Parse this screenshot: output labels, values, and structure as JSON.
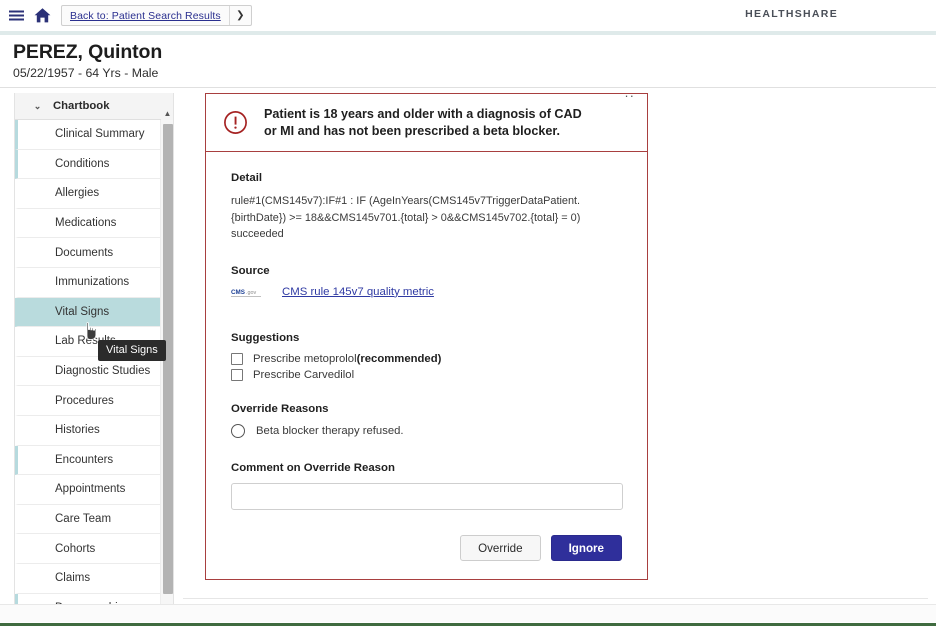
{
  "header": {
    "menu_icon": "hamburger-menu-icon",
    "home_icon": "home-icon",
    "back_crumb_label": "Back to: Patient Search Results",
    "back_crumb_arrow": "❯",
    "brand": "HEALTHSHARE"
  },
  "patient": {
    "name": "PEREZ, Quinton",
    "meta": "05/22/1957 - 64 Yrs - Male"
  },
  "sidebar": {
    "title": "Chartbook",
    "chevron": "⌄",
    "scrollbar_up_arrow": "▲",
    "items": [
      {
        "label": "Clinical Summary",
        "state": "accent"
      },
      {
        "label": "Conditions",
        "state": "accent"
      },
      {
        "label": "Allergies",
        "state": "normal"
      },
      {
        "label": "Medications",
        "state": "normal"
      },
      {
        "label": "Documents",
        "state": "normal"
      },
      {
        "label": "Immunizations",
        "state": "normal"
      },
      {
        "label": "Vital Signs",
        "state": "active"
      },
      {
        "label": "Lab Results",
        "state": "normal"
      },
      {
        "label": "Diagnostic Studies",
        "state": "normal"
      },
      {
        "label": "Procedures",
        "state": "normal"
      },
      {
        "label": "Histories",
        "state": "normal"
      },
      {
        "label": "Encounters",
        "state": "accent"
      },
      {
        "label": "Appointments",
        "state": "normal"
      },
      {
        "label": "Care Team",
        "state": "normal"
      },
      {
        "label": "Cohorts",
        "state": "normal"
      },
      {
        "label": "Claims",
        "state": "normal"
      },
      {
        "label": "Demographics",
        "state": "accent"
      }
    ]
  },
  "tooltip": {
    "text": "Vital Signs"
  },
  "alert": {
    "icon": "exclamation-circle-icon",
    "title": "Patient is 18 years and older with a diagnosis of CAD or MI and has not been prescribed a beta blocker.",
    "close_glyph": "··",
    "detail_label": "Detail",
    "detail_text": "rule#1(CMS145v7):IF#1 : IF (AgeInYears(CMS145v7TriggerDataPatient.{birthDate}) >= 18&&CMS145v701.{total} > 0&&CMS145v702.{total} = 0) succeeded",
    "source_label": "Source",
    "source_logo": "cms-gov-logo",
    "source_link": "CMS rule 145v7 quality metric",
    "suggestions_label": "Suggestions",
    "suggestions": [
      {
        "label": "Prescribe metoprolol ",
        "emphasis": "(recommended)",
        "checked": false
      },
      {
        "label": "Prescribe Carvedilol",
        "emphasis": "",
        "checked": false
      }
    ],
    "override_label": "Override Reasons",
    "override_reasons": [
      {
        "label": "Beta blocker therapy refused.",
        "selected": false
      }
    ],
    "comment_label": "Comment on Override Reason",
    "comment_value": "",
    "comment_placeholder": "",
    "override_button": "Override",
    "ignore_button": "Ignore"
  },
  "colors": {
    "alert_border": "#a83f3f",
    "primary_button": "#2f2f9b",
    "link": "#2f3aa3",
    "active_nav": "#b9dbdd",
    "footer_accent": "#3f6b3f"
  }
}
